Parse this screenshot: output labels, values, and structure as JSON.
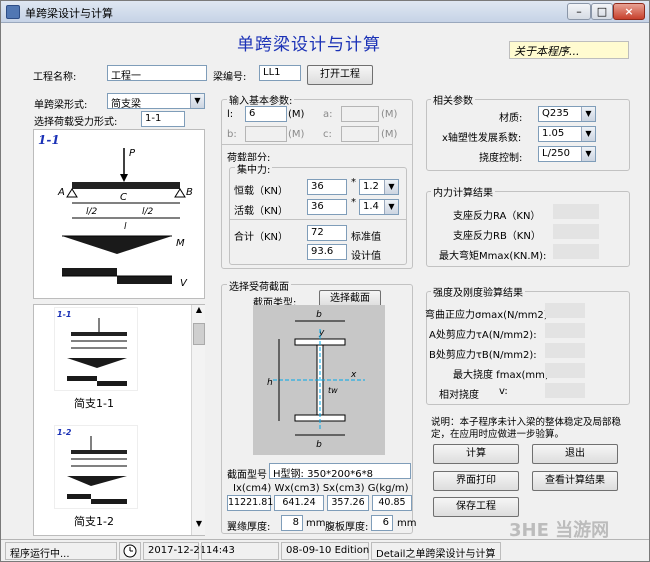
{
  "window": {
    "title": "单跨梁设计与计算",
    "controls": [
      "–",
      "□",
      "×"
    ]
  },
  "heading": "单跨梁设计与计算",
  "about_label": "关于本程序...",
  "project": {
    "name_label": "工程名称:",
    "name_value": "工程一",
    "beam_no_label": "梁编号:",
    "beam_no_value": "LL1",
    "open_label": "打开工程"
  },
  "beam_type": {
    "label": "单跨梁形式:",
    "value": "简支梁"
  },
  "load_form": {
    "label": "选择荷载受力形式:",
    "value": "1-1"
  },
  "diagram": {
    "code": "1-1",
    "P": "P",
    "A": "A",
    "B": "B",
    "C": "C",
    "half1": "l/2",
    "half2": "l/2",
    "span": "l",
    "M": "M",
    "V": "V"
  },
  "thumbs": [
    {
      "code": "1-1",
      "caption": "简支1-1"
    },
    {
      "code": "1-2",
      "caption": "简支1-2"
    }
  ],
  "basic_params": {
    "title": "输入基本参数:",
    "l_label": "l:",
    "l_value": "6",
    "l_unit": "(M)",
    "a_label": "a:",
    "a_unit": "(M)",
    "b_label": "b:",
    "b_unit": "(M)",
    "c_label": "c:",
    "c_unit": "(M)"
  },
  "load_section": {
    "title": "荷载部分:",
    "concentrated": "集中力:",
    "dead_label": "恒载（KN）",
    "dead_value": "36",
    "dead_factor": "1.2",
    "live_label": "活载（KN）",
    "live_value": "36",
    "live_factor": "1.4",
    "times": "*",
    "total_label": "合计（KN）",
    "total_std": "72",
    "std_label": "标准值",
    "total_design": "93.6",
    "design_label": "设计值"
  },
  "related": {
    "title": "相关参数",
    "material_label": "材质:",
    "material_value": "Q235",
    "gamma_label": "x轴塑性发展系数:",
    "gamma_value": "1.05",
    "deflect_label": "挠度控制:",
    "deflect_value": "L/250"
  },
  "internal": {
    "title": "内力计算结果",
    "ra": "支座反力RA（KN）",
    "rb": "支座反力RB（KN）",
    "mmax": "最大弯矩Mmax(KN.M):"
  },
  "section": {
    "title": "选择受荷截面",
    "type_label": "截面类型:",
    "choose_label": "选择截面",
    "img": {
      "b_top": "b",
      "y": "y",
      "h": "h",
      "x": "x",
      "tw": "tw",
      "b_bot": "b"
    },
    "model_label": "截面型号",
    "model_value": "H型钢: 350*200*6*8",
    "props_label": "Ix(cm4)  Wx(cm3)  Sx(cm3)  G(kg/m)",
    "ix": "11221.81",
    "wx": "641.24",
    "sx": "357.26",
    "g": "40.85",
    "flange_label": "翼缘厚度:",
    "flange_value": "8",
    "flange_unit": "mm",
    "web_label": "腹板厚度:",
    "web_value": "6",
    "web_unit": "mm"
  },
  "checks": {
    "title": "强度及刚度验算结果",
    "bending": "弯曲正应力σmax(N/mm2)",
    "shear_a": "A处剪应力τA(N/mm2):",
    "shear_b": "B处剪应力τB(N/mm2):",
    "fmax": "最大挠度  fmax(mm):",
    "rel": "相对挠度",
    "v": "v:"
  },
  "note": "说明：本子程序未计入梁的整体稳定及局部稳定，在应用时应做进一步验算。",
  "buttons": {
    "calc": "计算",
    "exit": "退出",
    "print": "界面打印",
    "view": "查看计算结果",
    "save": "保存工程"
  },
  "status": {
    "running": "程序运行中...",
    "date": "2017-12-21",
    "time": "14:43",
    "edition": "08-09-10 Edition",
    "detail": "Detail之单跨梁设计与计算"
  },
  "watermark": "3HE 当游网"
}
